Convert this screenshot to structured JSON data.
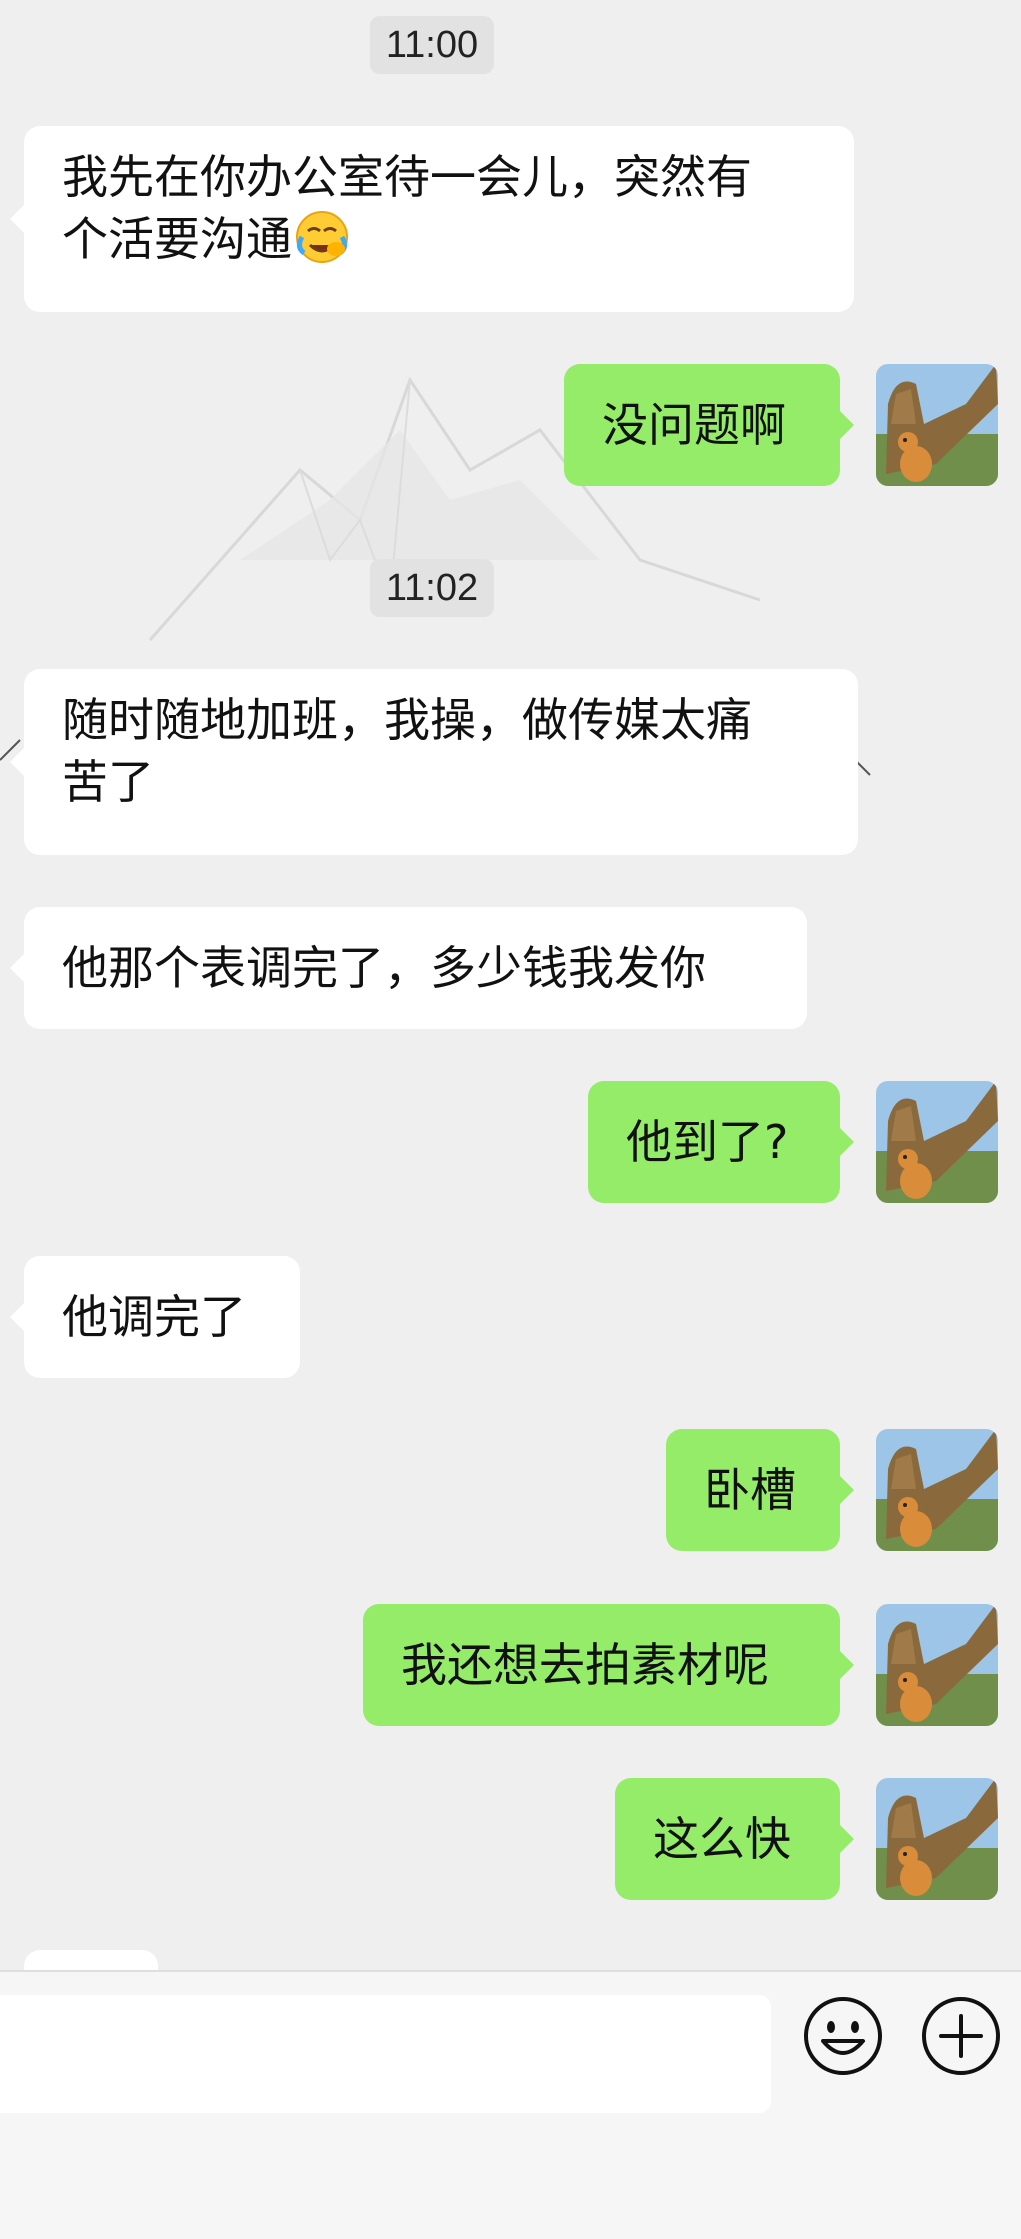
{
  "chat": {
    "messages": [
      {
        "type": "time",
        "text": "11:00"
      },
      {
        "type": "text",
        "side": "left",
        "text": "我先在你办公室待一会儿，突然有\n个活要沟通",
        "emoji": "face-holding-back-tears-icon"
      },
      {
        "type": "text",
        "side": "right",
        "text": "没问题啊"
      },
      {
        "type": "time",
        "text": "11:02"
      },
      {
        "type": "text",
        "side": "left",
        "text": "随时随地加班，我操，做传媒太痛\n苦了"
      },
      {
        "type": "text",
        "side": "left",
        "text": "他那个表调完了，多少钱我发你"
      },
      {
        "type": "text",
        "side": "right",
        "text": "他到了?"
      },
      {
        "type": "text",
        "side": "left",
        "text": "他调完了"
      },
      {
        "type": "text",
        "side": "right",
        "text": "卧槽"
      },
      {
        "type": "text",
        "side": "right",
        "text": "我还想去拍素材呢"
      },
      {
        "type": "text",
        "side": "right",
        "text": "这么快"
      }
    ]
  },
  "input_bar": {
    "text_value": "",
    "emoji_button_icon": "smiley-icon",
    "plus_button_icon": "plus-circle-icon"
  },
  "colors": {
    "chat_background": "#efefef",
    "incoming_bubble": "#ffffff",
    "outgoing_bubble": "#95ec69",
    "time_badge": "#e2e2e2",
    "input_bar": "#f6f6f6"
  }
}
